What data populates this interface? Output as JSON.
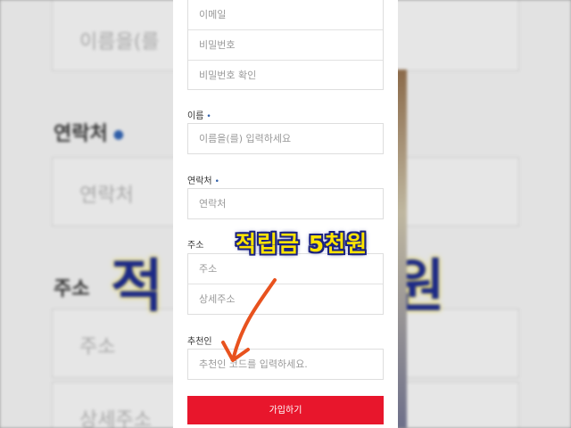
{
  "background": {
    "name_placeholder": "이름을(를",
    "contact_label": "연락처",
    "contact_placeholder": "연락처",
    "address_label": "주소",
    "address_placeholder": "주소",
    "address_detail_placeholder": "상세주소",
    "overlay_left": "적",
    "overlay_right": "원"
  },
  "form": {
    "account_fields": [
      {
        "placeholder": "이메일"
      },
      {
        "placeholder": "비밀번호"
      },
      {
        "placeholder": "비밀번호 확인"
      }
    ],
    "name": {
      "label": "이름",
      "required_mark": "•",
      "placeholder": "이름을(를) 입력하세요"
    },
    "contact": {
      "label": "연락처",
      "required_mark": "•",
      "placeholder": "연락처"
    },
    "address": {
      "label": "주소",
      "placeholder": "주소",
      "detail_placeholder": "상세주소"
    },
    "referrer": {
      "label": "추천인",
      "placeholder": "추천인 코드를 입력하세요."
    },
    "submit_label": "가입하기"
  },
  "overlay": {
    "caption": "적립금 5천원",
    "arrow_color": "#e8521e"
  },
  "colors": {
    "accent": "#e8162c",
    "required_dot": "#2f5ea8",
    "caption_fill": "#ffe400",
    "caption_outline": "#1a2280"
  }
}
